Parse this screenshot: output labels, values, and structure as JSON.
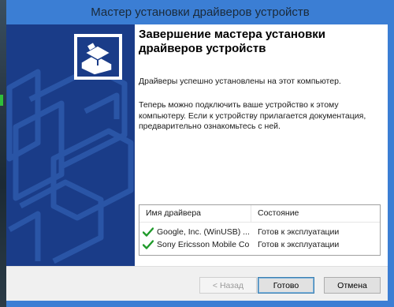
{
  "window": {
    "title": "Мастер установки драйверов устройств"
  },
  "content": {
    "heading_line1": "Завершение мастера установки",
    "heading_line2": "драйверов устройств",
    "para1": "Драйверы успешно установлены на этот компьютер.",
    "para2_line1": "Теперь можно подключить ваше устройство к этому",
    "para2_line2": "компьютеру. Если к устройству прилагается документация,",
    "para2_line3": "предварительно ознакомьтесь с ней."
  },
  "drivers_table": {
    "headers": [
      "Имя драйвера",
      "Состояние"
    ],
    "rows": [
      {
        "name": "Google, Inc. (WinUSB) ...",
        "status": "Готов к эксплуатации",
        "icon": "check-icon"
      },
      {
        "name": "Sony Ericsson Mobile Co...",
        "status": "Готов к эксплуатации",
        "icon": "check-icon"
      }
    ]
  },
  "buttons": {
    "back": "< Назад",
    "finish": "Готово",
    "cancel": "Отмена"
  },
  "colors": {
    "window_frame": "#3b7ed4",
    "side_panel": "#1a3c88",
    "check_green": "#1f9a2a"
  }
}
